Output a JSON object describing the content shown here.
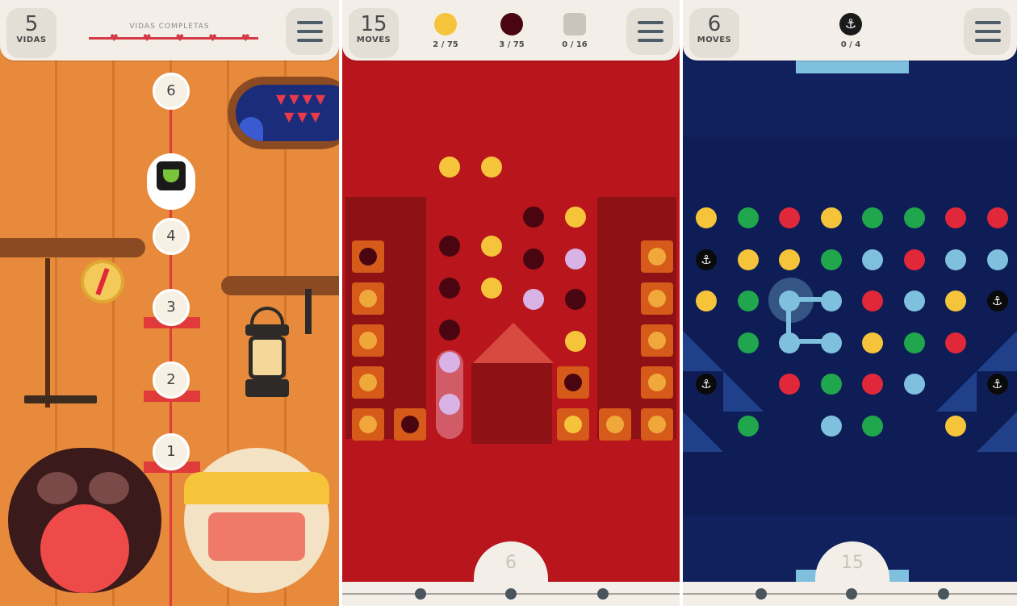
{
  "panel1": {
    "lives_count": "5",
    "lives_label": "VIDAS",
    "progress_label": "VIDAS COMPLETAS",
    "menu_icon": "menu-icon",
    "levels": [
      "6",
      "4",
      "3",
      "2",
      "1"
    ]
  },
  "panel2": {
    "moves_count": "15",
    "moves_label": "MOVES",
    "goals": [
      {
        "icon": "yellow-dot-icon",
        "color": "#f6c43a",
        "progress": "2 / 75"
      },
      {
        "icon": "dark-dot-icon",
        "color": "#4a0610",
        "progress": "3 / 75"
      },
      {
        "icon": "seed-icon",
        "color": "#c9c4bc",
        "progress": "0 / 16"
      }
    ],
    "level_number": "6"
  },
  "panel3": {
    "moves_count": "6",
    "moves_label": "MOVES",
    "goal": {
      "icon": "anchor-icon",
      "progress": "0 / 4"
    },
    "level_number": "15"
  },
  "colors": {
    "yellow": "#f6c43a",
    "green": "#20a64c",
    "red": "#e0283a",
    "blue": "#7fc0de",
    "dark": "#4a0610",
    "lilac": "#d9b3e6"
  }
}
